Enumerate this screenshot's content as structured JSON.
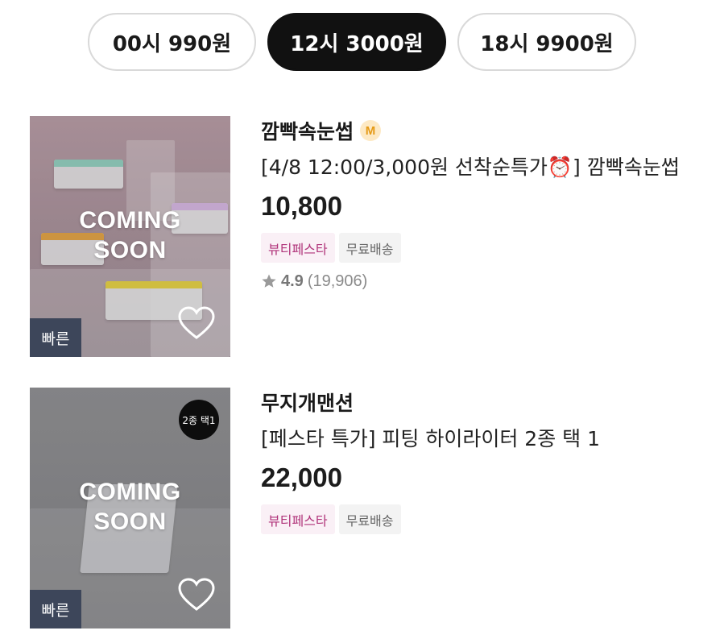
{
  "tabs": [
    {
      "label": "00시 990원",
      "active": false
    },
    {
      "label": "12시 3000원",
      "active": true
    },
    {
      "label": "18시 9900원",
      "active": false
    }
  ],
  "products": [
    {
      "image_overlay": "COMING\nSOON",
      "fast_badge": "빠른",
      "brand": "깜빡속눈썹",
      "brand_badge": "M",
      "title": "[4/8 12:00/3,000원 선착순특가⏰] 깜빡속눈썹",
      "price": "10,800",
      "tags": [
        "뷰티페스타",
        "무료배송"
      ],
      "rating": {
        "score": "4.9",
        "count": "(19,906)"
      }
    },
    {
      "image_overlay": "COMING\nSOON",
      "image_badge": "2종 택1",
      "fast_badge": "빠른",
      "brand": "무지개맨션",
      "title": "[페스타 특가] 피팅 하이라이터 2종 택 1",
      "price": "22,000",
      "tags": [
        "뷰티페스타",
        "무료배송"
      ]
    }
  ],
  "colors": {
    "active_tab_bg": "#111111",
    "festa_tag_text": "#b0337a",
    "fast_badge_bg": "#3d465a",
    "brand_badge_bg": "#fde9c4"
  },
  "icons": [
    "heart-icon",
    "star-icon"
  ]
}
